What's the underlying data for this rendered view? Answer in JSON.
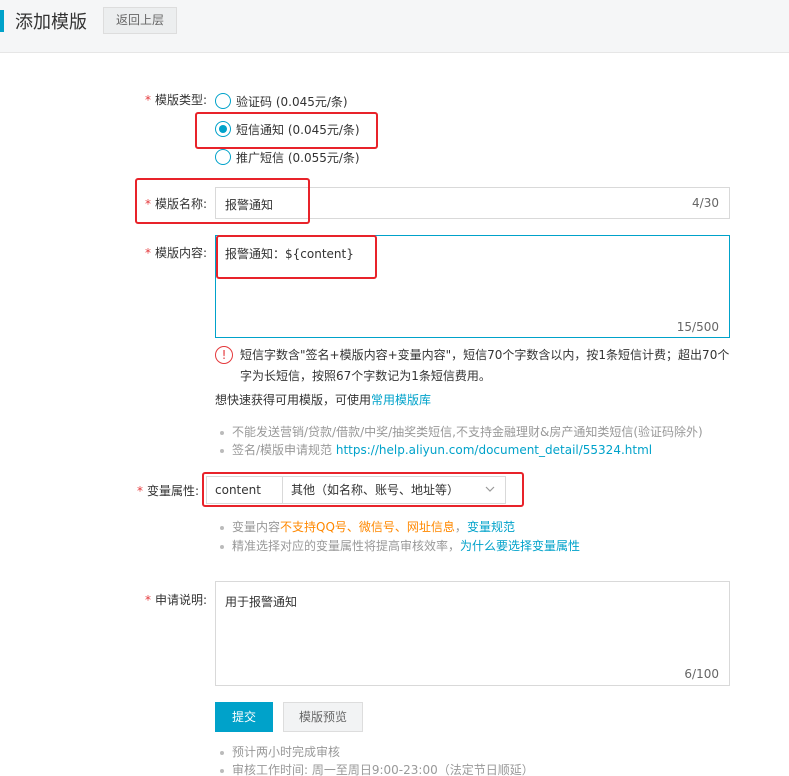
{
  "header": {
    "title": "添加模版",
    "back_label": "返回上层"
  },
  "template_type": {
    "label": "模版类型:",
    "options": [
      {
        "label": "验证码 (0.045元/条)",
        "checked": false
      },
      {
        "label": "短信通知 (0.045元/条)",
        "checked": true
      },
      {
        "label": "推广短信 (0.055元/条)",
        "checked": false
      }
    ]
  },
  "template_name": {
    "label": "模版名称:",
    "value": "报警通知",
    "count": "4/30"
  },
  "template_content": {
    "label": "模版内容:",
    "value": "报警通知：${content}",
    "count": "15/500",
    "warning": "短信字数含\"签名+模版内容+变量内容\"，短信70个字数含以内，按1条短信计费；超出70个字为长短信，按照67个字数记为1条短信费用。",
    "quick_prefix": "想快速获得可用模版，可使用",
    "quick_link": "常用模版库",
    "notes": [
      "不能发送营销/贷款/借款/中奖/抽奖类短信,不支持金融理财&房产通知类短信(验证码除外)",
      "签名/模版申请规范"
    ],
    "spec_link": "https://help.aliyun.com/document_detail/55324.html"
  },
  "variable": {
    "label": "变量属性:",
    "name": "content",
    "type_value": "其他（如名称、账号、地址等）",
    "notes": {
      "n1_prefix": "变量内容",
      "n1_orange": "不支持QQ号、微信号、网址信息",
      "n1_sep": "，",
      "n1_link": "变量规范",
      "n2_prefix": "精准选择对应的变量属性将提高审核效率，",
      "n2_link": "为什么要选择变量属性"
    }
  },
  "apply": {
    "label": "申请说明:",
    "value": "用于报警通知",
    "count": "6/100"
  },
  "actions": {
    "submit": "提交",
    "preview": "模版预览"
  },
  "footer_notes": [
    "预计两小时完成审核",
    "审核工作时间: 周一至周日9:00-23:00（法定节日顺延）"
  ],
  "colors": {
    "accent": "#00a2ca",
    "required": "#e4393c",
    "highlight_box": "#e8232a",
    "orange": "#ff8800"
  }
}
